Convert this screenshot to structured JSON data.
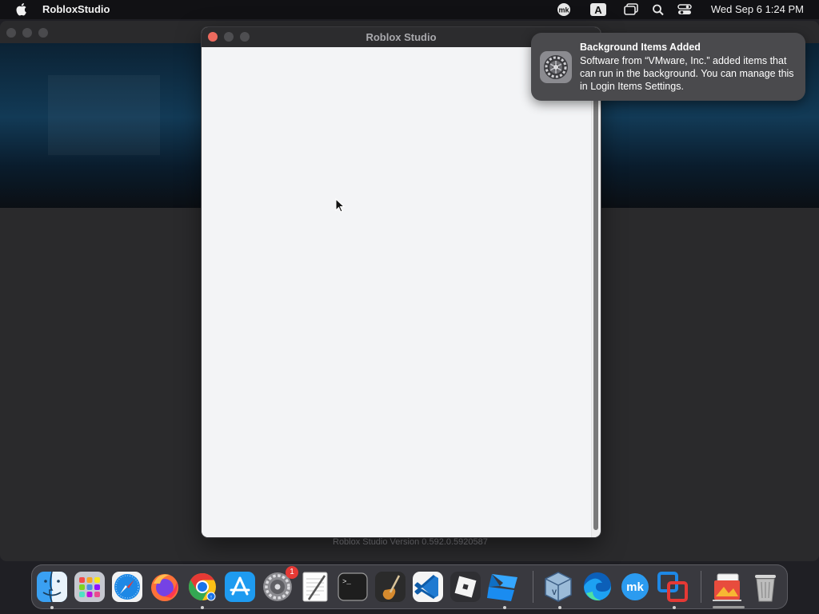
{
  "menubar": {
    "app_name": "RobloxStudio",
    "clock": "Wed Sep 6  1:24 PM"
  },
  "window": {
    "title": "Roblox Studio"
  },
  "background_window": {
    "version_text": "Roblox Studio Version 0.592.0.5920587"
  },
  "notification": {
    "title": "Background Items Added",
    "body": "Software from “VMware, Inc.” added items that can run in the background. You can manage this in Login Items Settings."
  },
  "dock": {
    "items": [
      {
        "name": "finder-icon",
        "running": true
      },
      {
        "name": "launchpad-icon",
        "running": false
      },
      {
        "name": "safari-icon",
        "running": false
      },
      {
        "name": "firefox-icon",
        "running": false
      },
      {
        "name": "chrome-icon",
        "running": true
      },
      {
        "name": "app-store-icon",
        "running": false
      },
      {
        "name": "system-settings-icon",
        "running": false,
        "badge": "1"
      },
      {
        "name": "textedit-icon",
        "running": false
      },
      {
        "name": "terminal-icon",
        "running": false
      },
      {
        "name": "garageband-icon",
        "running": false
      },
      {
        "name": "vscode-icon",
        "running": false
      },
      {
        "name": "roblox-player-icon",
        "running": false
      },
      {
        "name": "roblox-studio-icon",
        "running": true
      },
      {
        "name": "virtualbox-icon",
        "running": true
      },
      {
        "name": "edge-icon",
        "running": false
      },
      {
        "name": "mk-app-icon",
        "running": false
      },
      {
        "name": "vmware-fusion-icon",
        "running": true
      },
      {
        "name": "downloads-stack-icon",
        "running": false
      },
      {
        "name": "trash-icon",
        "running": false
      }
    ]
  }
}
